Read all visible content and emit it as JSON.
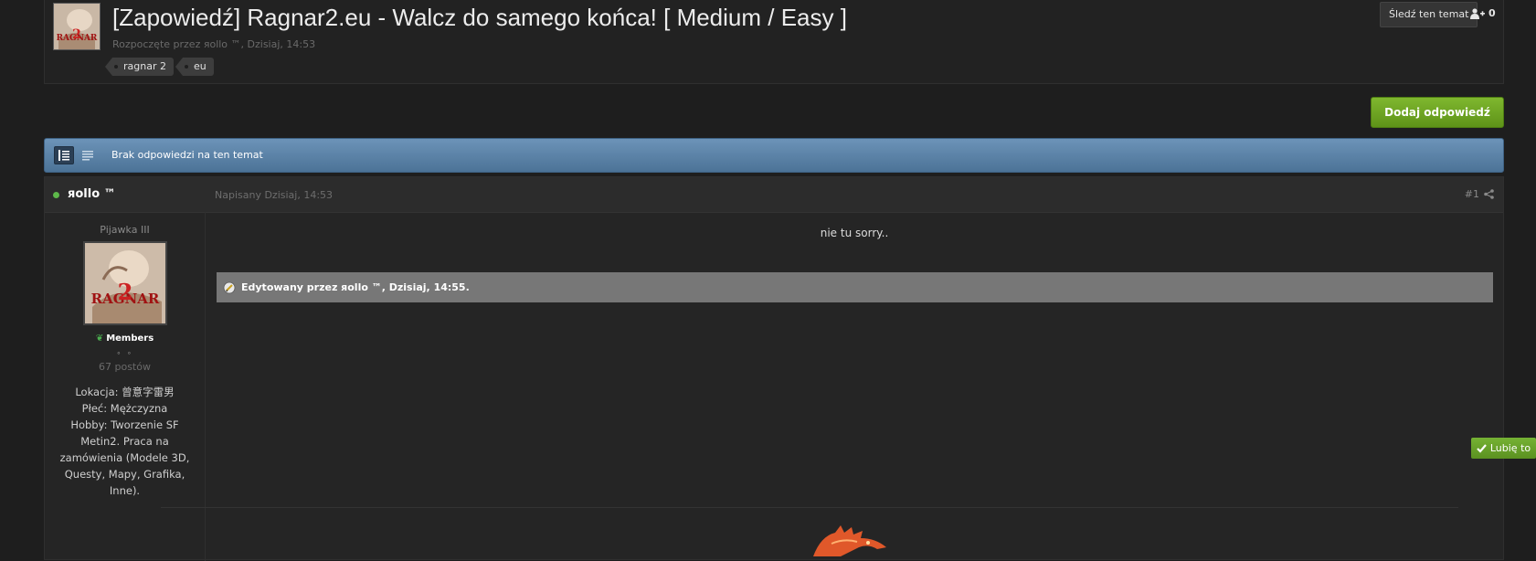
{
  "topic": {
    "title": "[Zapowiedź] Ragnar2.eu - Walcz do samego końca! [ Medium / Easy ]",
    "meta": "Rozpoczęte przez яollo ™, Dzisiaj, 14:53",
    "tags": [
      "ragnar 2",
      "eu"
    ],
    "follow_label": "Śledź ten temat",
    "followers_count": "0",
    "avatar_text": "RAGNAR",
    "avatar_number": "2"
  },
  "actions": {
    "reply_label": "Dodaj odpowiedź"
  },
  "bar": {
    "text": "Brak odpowiedzi na ten temat"
  },
  "post": {
    "author": "яollo ™",
    "date": "Napisany Dzisiaj, 14:53",
    "number": "#1",
    "rank": "Pijawka III",
    "group": "Members",
    "pips": "∘ ∘",
    "posts_count": "67 postów",
    "profile_fields": "Lokacja: 曾意字雷男\nPłeć: Mężczyzna\nHobby: Tworzenie SF Metin2. Praca na zamówienia (Modele 3D, Questy, Mapy, Grafika, Inne).",
    "content": "nie tu sorry..",
    "edited": "Edytowany przez яollo ™, Dzisiaj, 14:55.",
    "like_label": "Lubię to"
  },
  "colors": {
    "accent_green": "#6ea628",
    "bar_blue": "#5b83a8",
    "online": "#5db84a"
  }
}
